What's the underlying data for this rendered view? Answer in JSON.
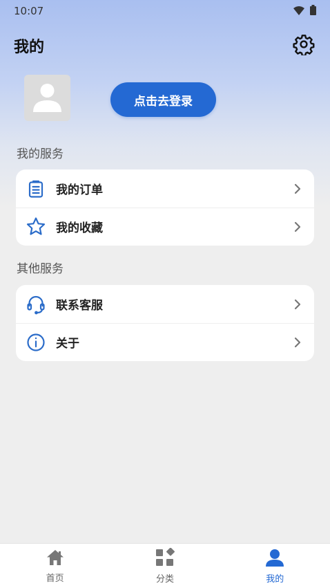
{
  "status_bar": {
    "time": "10:07",
    "icons": [
      "wifi-icon",
      "battery-icon"
    ]
  },
  "header": {
    "title": "我的",
    "settings_icon": "gear-icon"
  },
  "profile": {
    "avatar_icon": "user-placeholder-icon",
    "login_label": "点击去登录"
  },
  "sections": [
    {
      "title": "我的服务",
      "items": [
        {
          "label": "我的订单",
          "icon": "clipboard-list-icon"
        },
        {
          "label": "我的收藏",
          "icon": "star-icon"
        }
      ]
    },
    {
      "title": "其他服务",
      "items": [
        {
          "label": "联系客服",
          "icon": "headset-icon"
        },
        {
          "label": "关于",
          "icon": "info-icon"
        }
      ]
    }
  ],
  "tabbar": {
    "items": [
      {
        "label": "首页",
        "icon": "home-icon",
        "active": false
      },
      {
        "label": "分类",
        "icon": "category-grid-icon",
        "active": false
      },
      {
        "label": "我的",
        "icon": "user-icon",
        "active": true
      }
    ]
  },
  "colors": {
    "accent": "#2469d3",
    "icon_blue": "#2b6cc9",
    "background": "#eeeeee"
  }
}
